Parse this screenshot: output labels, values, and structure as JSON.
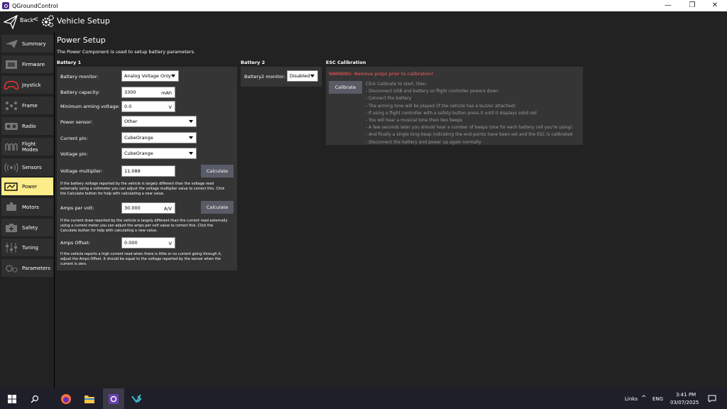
{
  "window": {
    "title": "QGroundControl",
    "minimize": "—",
    "maximize": "❐",
    "close": "✕"
  },
  "header": {
    "back_label": "Back",
    "back_chevron": "<",
    "title": "Vehicle Setup"
  },
  "sidebar": {
    "items": [
      {
        "label": "Summary",
        "icon": "plane-icon"
      },
      {
        "label": "Firmware",
        "icon": "firmware-icon"
      },
      {
        "label": "Joystick",
        "icon": "joystick-icon"
      },
      {
        "label": "Frame",
        "icon": "frame-icon"
      },
      {
        "label": "Radio",
        "icon": "radio-icon"
      },
      {
        "label": "Flight Modes",
        "icon": "flight-modes-icon"
      },
      {
        "label": "Sensors",
        "icon": "sensors-icon"
      },
      {
        "label": "Power",
        "icon": "power-icon",
        "active": true
      },
      {
        "label": "Motors",
        "icon": "motors-icon"
      },
      {
        "label": "Safety",
        "icon": "safety-icon"
      },
      {
        "label": "Tuning",
        "icon": "tuning-icon"
      },
      {
        "label": "Parameters",
        "icon": "parameters-icon"
      }
    ]
  },
  "main": {
    "title": "Power Setup",
    "description": "The Power Component is used to setup battery parameters."
  },
  "battery1": {
    "section_title": "Battery 1",
    "monitor_label": "Battery monitor:",
    "monitor_value": "Analog Voltage Only",
    "capacity_label": "Battery capacity:",
    "capacity_value": "3300",
    "capacity_unit": "mAh",
    "min_arming_label": "Minimum arming voltage:",
    "min_arming_value": "0.0",
    "min_arming_unit": "V",
    "power_sensor_label": "Power sensor:",
    "power_sensor_value": "Other",
    "current_pin_label": "Current pin:",
    "current_pin_value": "CubeOrange",
    "voltage_pin_label": "Voltage pin:",
    "voltage_pin_value": "CubeOrange",
    "voltage_mult_label": "Voltage multiplier:",
    "voltage_mult_value": "11.088",
    "calculate_label": "Calculate",
    "voltage_help_1": "If the battery voltage reported by the vehicle is largely different than the voltage read",
    "voltage_help_2": "externally using a voltmeter you can adjust the voltage multiplier value to correct this. Click",
    "voltage_help_3": "the Calculate button for help with calculating a new value.",
    "amps_per_volt_label": "Amps per volt:",
    "amps_per_volt_value": "30.000",
    "amps_per_volt_unit": "A/V",
    "current_help_1": "If the current draw reported by the vehicle is largely different than the current read externally",
    "current_help_2": "using a current meter you can adjust the amps per volt value to correct this. Click the",
    "current_help_3": "Calculate button for help with calculating a new value.",
    "amps_offset_label": "Amps Offset:",
    "amps_offset_value": "0.000",
    "amps_offset_unit": "V",
    "offset_help_1": "If the vehicle reports a high current read when there is little or no current going through it,",
    "offset_help_2": "adjust the Amps Offset. It should be equal to the voltage reported by the sensor when the",
    "offset_help_3": "current is zero."
  },
  "battery2": {
    "section_title": "Battery 2",
    "monitor_label": "Battery2 monitor:",
    "monitor_value": "Disabled"
  },
  "esc": {
    "section_title": "ESC Calibration",
    "warning": "WARNING: Remove props prior to calibration!",
    "calibrate_label": "Calibrate",
    "steps": [
      "Click Calibrate to start, then:",
      "- Disconnect USB and battery so flight controller powers down",
      "- Connect the battery",
      "- The arming tone will be played (if the vehicle has a buzzer attached)",
      "- If using a flight controller with a safety button press it until it displays solid red",
      "- You will hear a musical tone then two beeps",
      "- A few seconds later you should hear a number of beeps (one for each battery cell you're using)",
      "- And finally a single long beep indicating the end points have been set and the ESC is calibrated",
      "- Disconnect the battery and power up again normally"
    ]
  },
  "taskbar": {
    "links_label": "Links",
    "lang": "ENG",
    "time": "3:41 PM",
    "date": "03/07/2025",
    "up_chevron": "^"
  },
  "colors": {
    "background": "#222222",
    "panel": "#353535",
    "active_nav": "#fcec8a",
    "button": "#595b66",
    "warning": "#ff5e5e"
  }
}
